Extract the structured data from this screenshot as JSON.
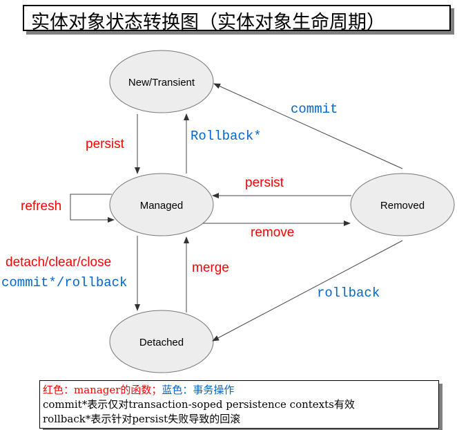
{
  "title": "实体对象状态转换图（实体对象生命周期）",
  "states": {
    "new_transient": "New/Transient",
    "managed": "Managed",
    "removed": "Removed",
    "detached": "Detached"
  },
  "transitions": {
    "persist_new_to_managed": "persist",
    "rollback_managed_to_new": "Rollback*",
    "commit_removed_to_new": "commit",
    "refresh": "refresh",
    "persist_removed_to_managed": "persist",
    "remove": "remove",
    "detach_clear_close": "detach/clear/close",
    "commit_rollback": "commit*/rollback",
    "merge": "merge",
    "rollback_removed_to_detached": "rollback"
  },
  "colors": {
    "red": "#ff0000",
    "blue": "#0066cc",
    "node_fill": "#ededed"
  },
  "notes": {
    "legend_red": "红色：manager的函数；",
    "legend_blue": "蓝色：事务操作",
    "line2": "commit*表示仅对transaction-soped persistence contexts有效",
    "line3": "rollback*表示针对persist失败导致的回滚"
  }
}
